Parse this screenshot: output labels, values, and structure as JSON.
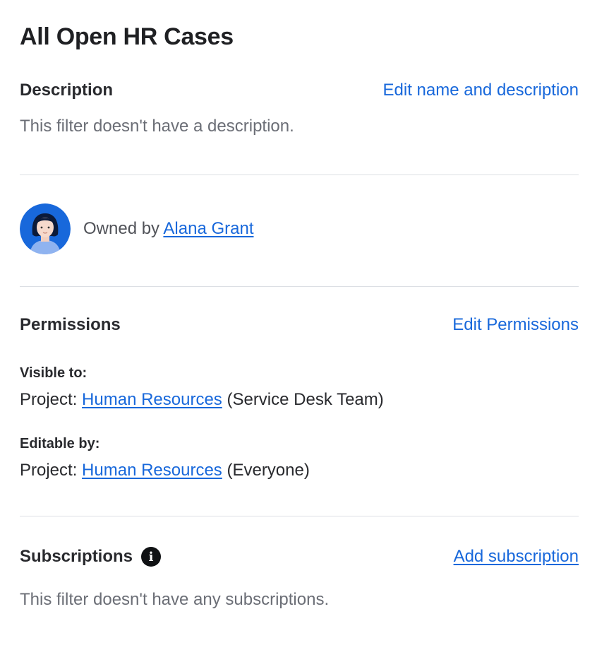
{
  "title": "All Open HR Cases",
  "description": {
    "heading": "Description",
    "edit_label": "Edit name and description",
    "text": "This filter doesn't have a description."
  },
  "owner": {
    "prefix": "Owned by",
    "name": "Alana Grant"
  },
  "permissions": {
    "heading": "Permissions",
    "edit_label": "Edit Permissions",
    "visible": {
      "label": "Visible to:",
      "prefix": "Project:",
      "project": "Human Resources",
      "suffix": "(Service Desk Team)"
    },
    "editable": {
      "label": "Editable by:",
      "prefix": "Project:",
      "project": "Human Resources",
      "suffix": "(Everyone)"
    }
  },
  "subscriptions": {
    "heading": "Subscriptions",
    "add_label": "Add subscription",
    "text": "This filter doesn't have any subscriptions.",
    "info_icon": "info-icon"
  },
  "colors": {
    "link": "#1868db",
    "muted_text": "#6b6e76",
    "avatar_bg": "#1868db"
  }
}
